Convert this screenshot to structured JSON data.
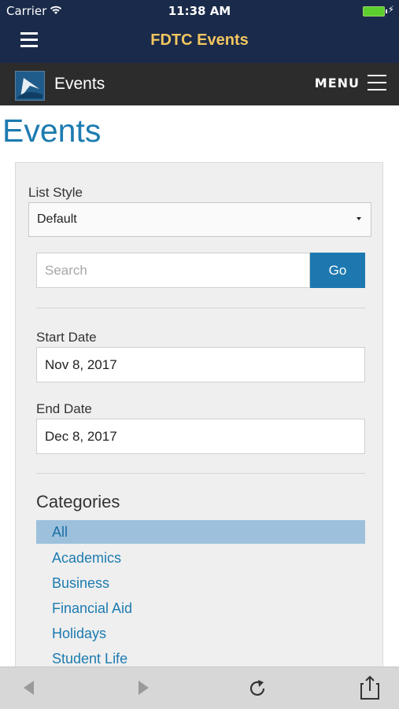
{
  "status_bar": {
    "carrier": "Carrier",
    "time": "11:38 AM"
  },
  "app_header": {
    "title": "FDTC Events"
  },
  "site_header": {
    "title": "Events",
    "menu_label": "MENU"
  },
  "page": {
    "title": "Events"
  },
  "filters": {
    "list_style_label": "List Style",
    "list_style_value": "Default",
    "search_placeholder": "Search",
    "go_label": "Go",
    "start_date_label": "Start Date",
    "start_date_value": "Nov 8, 2017",
    "end_date_label": "End Date",
    "end_date_value": "Dec 8, 2017",
    "categories_title": "Categories",
    "categories": [
      {
        "label": "All",
        "selected": true
      },
      {
        "label": "Academics",
        "selected": false
      },
      {
        "label": "Business",
        "selected": false
      },
      {
        "label": "Financial Aid",
        "selected": false
      },
      {
        "label": "Holidays",
        "selected": false
      },
      {
        "label": "Student Life",
        "selected": false
      }
    ]
  },
  "colors": {
    "app_bar": "#1a2a4a",
    "app_title": "#f2c660",
    "accent": "#1d78b0",
    "selected_category": "#9dc1dd"
  },
  "icons": {
    "app_menu": "hamburger-icon",
    "site_menu": "hamburger-icon",
    "logo": "fdtc-logo",
    "back": "back-arrow-icon",
    "forward": "forward-arrow-icon",
    "reload": "reload-icon",
    "share": "share-icon"
  }
}
